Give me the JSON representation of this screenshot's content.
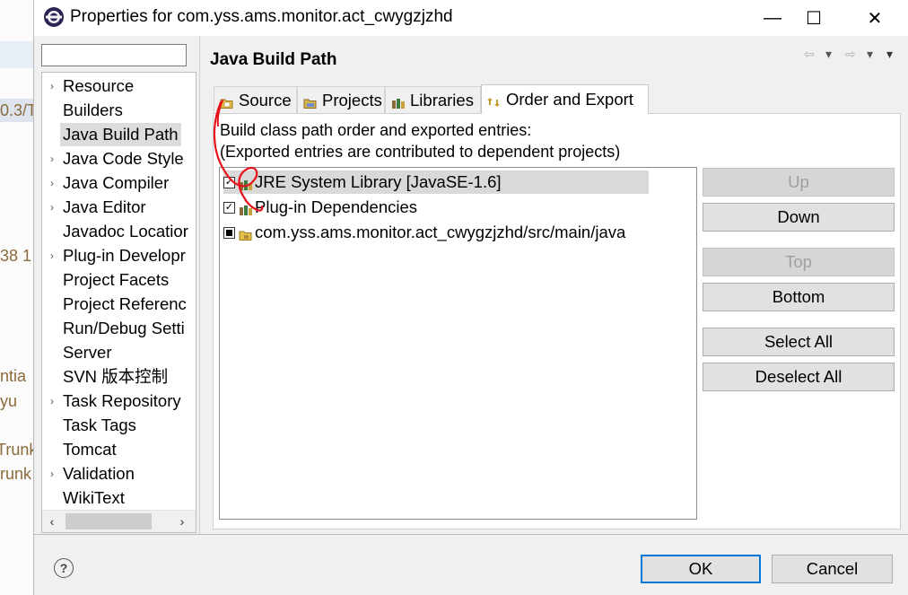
{
  "window": {
    "title": "Properties for com.yss.ams.monitor.act_cwygzjzhd",
    "minimize": "—",
    "maximize": "☐",
    "close": "✕"
  },
  "background_fragments": [
    "0.3/T",
    "38  1",
    "ntia",
    "yu",
    "Trunk",
    "runk"
  ],
  "filter": {
    "value": ""
  },
  "nav": {
    "items": [
      {
        "label": "Resource",
        "expandable": true
      },
      {
        "label": "Builders",
        "expandable": false
      },
      {
        "label": "Java Build Path",
        "expandable": false,
        "selected": true
      },
      {
        "label": "Java Code Style",
        "expandable": true
      },
      {
        "label": "Java Compiler",
        "expandable": true
      },
      {
        "label": "Java Editor",
        "expandable": true
      },
      {
        "label": "Javadoc Locatior",
        "expandable": false
      },
      {
        "label": "Plug-in Developr",
        "expandable": true
      },
      {
        "label": "Project Facets",
        "expandable": false
      },
      {
        "label": "Project Referenc",
        "expandable": false
      },
      {
        "label": "Run/Debug Setti",
        "expandable": false
      },
      {
        "label": "Server",
        "expandable": false
      },
      {
        "label": "SVN 版本控制",
        "expandable": false
      },
      {
        "label": "Task Repository",
        "expandable": true
      },
      {
        "label": "Task Tags",
        "expandable": false
      },
      {
        "label": "Tomcat",
        "expandable": false
      },
      {
        "label": "Validation",
        "expandable": true
      },
      {
        "label": "WikiText",
        "expandable": false
      }
    ]
  },
  "page": {
    "title": "Java Build Path",
    "tabs": [
      {
        "label": "Source",
        "icon": "source-folder-icon"
      },
      {
        "label": "Projects",
        "icon": "projects-icon"
      },
      {
        "label": "Libraries",
        "icon": "libraries-icon"
      },
      {
        "label": "Order and Export",
        "icon": "order-export-icon",
        "active": true
      }
    ],
    "description_line1": "Build class path order and exported entries:",
    "description_line2": "(Exported entries are contributed to dependent projects)",
    "entries": [
      {
        "label": "JRE System Library [JavaSE-1.6]",
        "checked": true,
        "highlighted": true,
        "icon": "library-icon"
      },
      {
        "label": "Plug-in Dependencies",
        "checked": true,
        "highlighted": false,
        "icon": "library-icon"
      },
      {
        "label": "com.yss.ams.monitor.act_cwygzjzhd/src/main/java",
        "checked": "partial",
        "highlighted": false,
        "icon": "package-folder-icon"
      }
    ],
    "buttons": {
      "up": "Up",
      "down": "Down",
      "top": "Top",
      "bottom": "Bottom",
      "select_all": "Select All",
      "deselect_all": "Deselect All"
    }
  },
  "footer": {
    "ok": "OK",
    "cancel": "Cancel"
  },
  "colors": {
    "annotation": "#e8101a",
    "default_button_border": "#0078d7",
    "selection": "#dcdcdc"
  }
}
